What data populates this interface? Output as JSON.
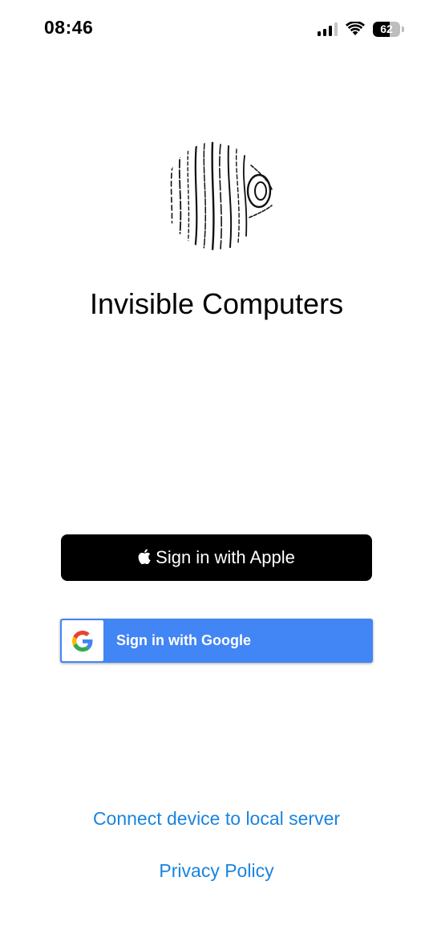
{
  "status_bar": {
    "time": "08:46",
    "battery_percent": "62",
    "signal_bars_active": 3,
    "signal_bars_total": 4,
    "wifi": "wifi-icon"
  },
  "app": {
    "title": "Invisible Computers",
    "logo": "wood-grain-logo"
  },
  "auth": {
    "apple_label": "Sign in with Apple",
    "google_label": "Sign in with Google"
  },
  "links": {
    "connect_local": "Connect device to local server",
    "privacy": "Privacy Policy"
  },
  "colors": {
    "apple_button_bg": "#000000",
    "google_button_bg": "#4285F4",
    "link": "#1a84e0"
  }
}
